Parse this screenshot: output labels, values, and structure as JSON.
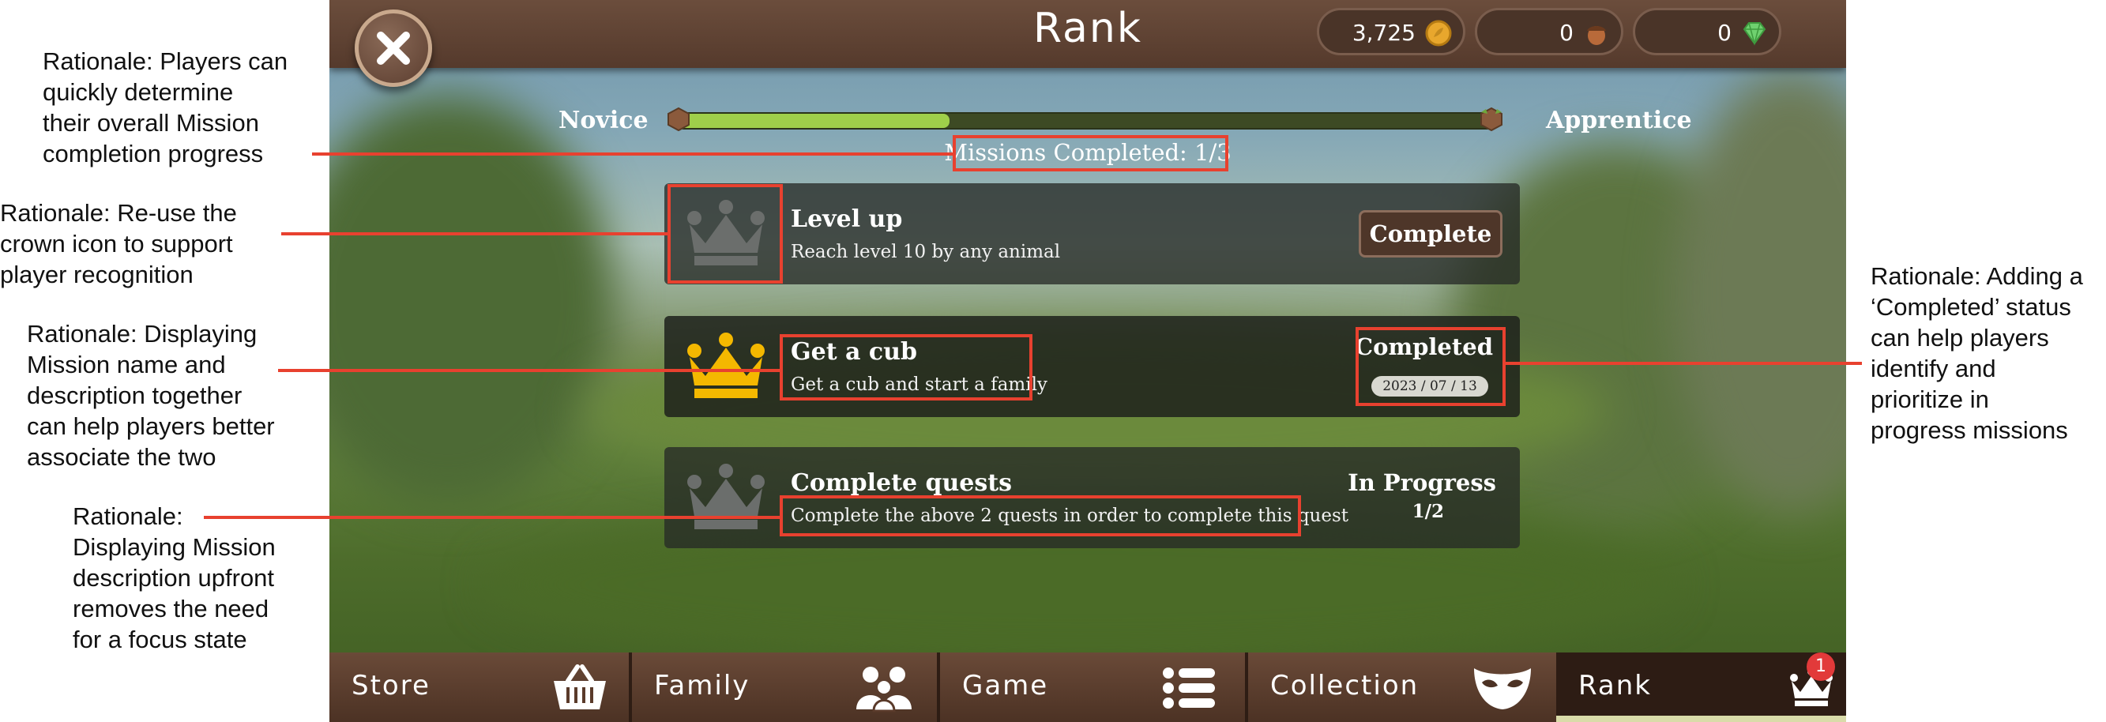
{
  "header": {
    "title": "Rank"
  },
  "currencies": [
    {
      "name": "coins",
      "value": "3,725",
      "icon": "coin-icon",
      "color": "#e8a72d"
    },
    {
      "name": "acorns",
      "value": "0",
      "icon": "acorn-icon",
      "color": "#8a4a2a"
    },
    {
      "name": "gems",
      "value": "0",
      "icon": "gem-icon",
      "color": "#6fd16f"
    }
  ],
  "progress": {
    "from_label": "Novice",
    "to_label": "Apprentice",
    "fraction": 0.333,
    "missions_text": "Missions Completed: 1/3"
  },
  "missions": [
    {
      "title": "Level up",
      "description": "Reach level 10 by any animal",
      "action": "Complete",
      "crown": "gray"
    },
    {
      "title": "Get a cub",
      "description": "Get a cub and start a family",
      "status": "Completed",
      "date": "2023 / 07 / 13",
      "crown": "gold"
    },
    {
      "title": "Complete quests",
      "description": "Complete the above 2 quests in order to complete this quest",
      "status": "In Progress",
      "progress": "1/2",
      "crown": "gray"
    }
  ],
  "tabs": [
    {
      "label": "Store",
      "icon": "basket-icon"
    },
    {
      "label": "Family",
      "icon": "family-icon"
    },
    {
      "label": "Game",
      "icon": "list-icon"
    },
    {
      "label": "Collection",
      "icon": "mask-icon"
    },
    {
      "label": "Rank",
      "icon": "crown-icon",
      "active": true,
      "badge": "1"
    }
  ],
  "annotations": {
    "progress": [
      "Rationale: Players can",
      "quickly determine",
      "their overall Mission",
      "completion progress"
    ],
    "crown": [
      "Rationale: Re-use the",
      "crown icon to support",
      "player recognition"
    ],
    "name_desc": [
      "Rationale: Displaying",
      "Mission name and",
      "description together",
      "can help players better",
      "associate the two"
    ],
    "desc_upfront": [
      "Rationale:",
      "Displaying Mission",
      "description upfront",
      "removes the need",
      "for a focus state"
    ],
    "completed": [
      "Rationale: Adding a",
      "‘Completed’ status",
      "can help players",
      "identify and",
      "prioritize in",
      "progress missions"
    ]
  },
  "colors": {
    "annotation": "#e8412f",
    "progress_fill": "#9fcf4a",
    "gold_crown": "#f4b800",
    "gray_crown": "#6b6e6c"
  }
}
